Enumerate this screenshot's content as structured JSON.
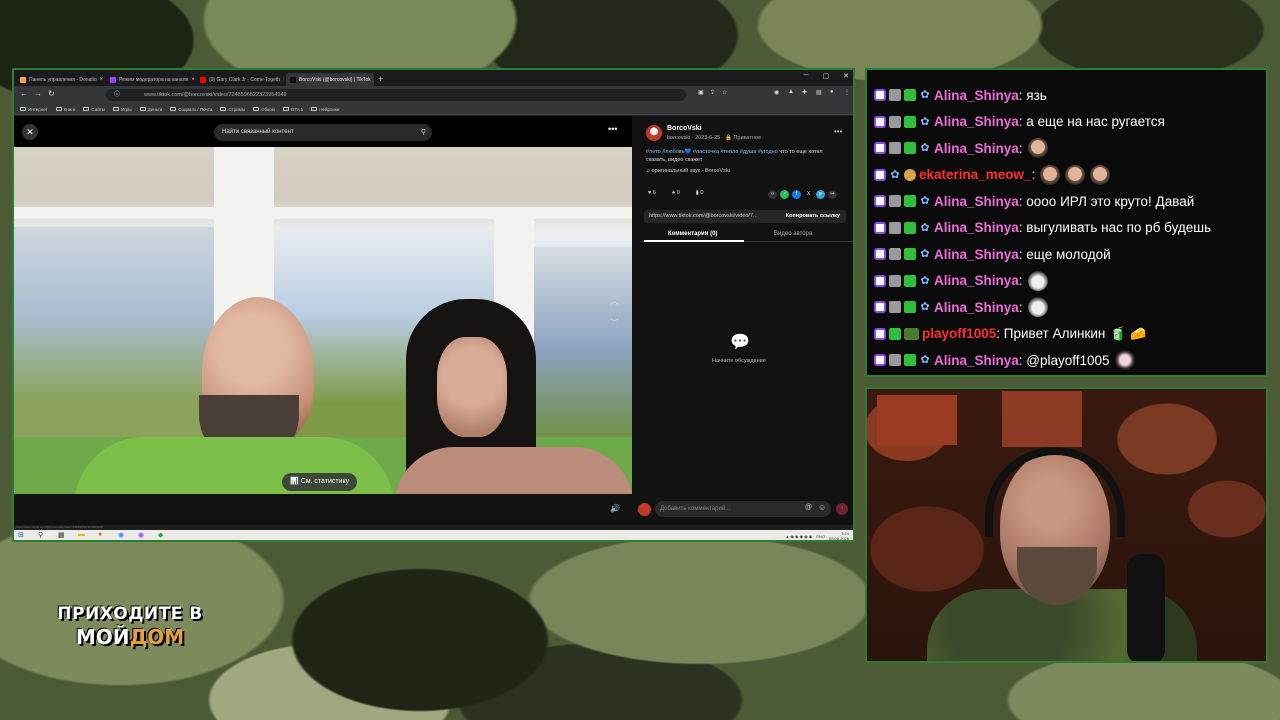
{
  "browser": {
    "tabs": [
      {
        "label": "Панель управления - Donatio",
        "color": "#f4a742",
        "active": false
      },
      {
        "label": "Режим модератора на канале",
        "color": "#9146ff",
        "active": false
      },
      {
        "label": "(9) Gary Clark Jr - Come Togeth",
        "color": "#ff0000",
        "active": false
      },
      {
        "label": "BorcoVski (@borcovski) | TikTok",
        "color": "#111111",
        "active": true
      }
    ],
    "url": "www.tiktok.com/@borcovski/video/7248596522323954949",
    "bookmarks": [
      "Интернет",
      "Книги",
      "Сайты",
      "Игры",
      "Деньги",
      "Социалк / Почта",
      "Стримы",
      "Обком",
      "GTA 5",
      "Нейронки"
    ]
  },
  "tiktok": {
    "search_placeholder": "Найти связанный контент",
    "stats_button": "См. статистику",
    "comment_placeholder": "Добавить комментарий...",
    "author": {
      "name": "BorcoVski",
      "meta": "borcovski · 2023-6-25 · 🔒 Приватное"
    },
    "caption_tags": "#лето #любовь💙 #ласточка #тепло #душа #угодно",
    "caption_text": " что то еще хотел сказать, видео скажет",
    "sound": "оригинальный звук - BorcoVski",
    "likes": "6",
    "comments": "0",
    "saves": "0",
    "link": "https://www.tiktok.com/@borcovski/video/7...",
    "copy_link": "Копировать ссылку",
    "tab_comments": "Комментарии (0)",
    "tab_author": "Видео автора",
    "empty_text": "Начните обсуждение"
  },
  "taskbar": {
    "lang": "ENG",
    "time": "3:24",
    "date": "08.06.2026",
    "status_url": "https://www.tiktok.com/@borcovski/video/7248596522323954949"
  },
  "chat": {
    "messages": [
      {
        "user": "Alina_Shinya",
        "color": "pink",
        "badge": "plant",
        "text": ": язь",
        "emotes": []
      },
      {
        "user": "Alina_Shinya",
        "color": "pink",
        "badge": "plant",
        "text": ": а еще на нас ругается",
        "emotes": []
      },
      {
        "user": "Alina_Shinya",
        "color": "pink",
        "badge": "plant",
        "text": ":",
        "emotes": [
          "face"
        ]
      },
      {
        "user": "ekaterina_meow_",
        "color": "red",
        "badge": "sub",
        "text": ":",
        "emotes": [
          "face",
          "face",
          "face"
        ]
      },
      {
        "user": "Alina_Shinya",
        "color": "pink",
        "badge": "plant",
        "text": ": оооо ИРЛ это круто! Давай",
        "emotes": []
      },
      {
        "user": "Alina_Shinya",
        "color": "pink",
        "badge": "plant",
        "text": ": выгуливать нас по рб будешь",
        "emotes": []
      },
      {
        "user": "Alina_Shinya",
        "color": "pink",
        "badge": "plant",
        "text": ": еще молодой",
        "emotes": []
      },
      {
        "user": "Alina_Shinya",
        "color": "pink",
        "badge": "plant",
        "text": ":",
        "emotes": [
          "w"
        ]
      },
      {
        "user": "Alina_Shinya",
        "color": "pink",
        "badge": "plant",
        "text": ":",
        "emotes": [
          "w"
        ]
      },
      {
        "user": "playoff1005",
        "color": "red",
        "badge": "pill",
        "text": ": Привет Алинкин",
        "emotes": [
          "mini"
        ]
      },
      {
        "user": "Alina_Shinya",
        "color": "pink",
        "badge": "plant",
        "text": ": @playoff1005",
        "emotes": [
          "k"
        ]
      }
    ]
  },
  "promo": {
    "line1": "ПРИХОДИТЕ В",
    "line2_a": "МОЙ",
    "line2_b": "ДОМ"
  }
}
